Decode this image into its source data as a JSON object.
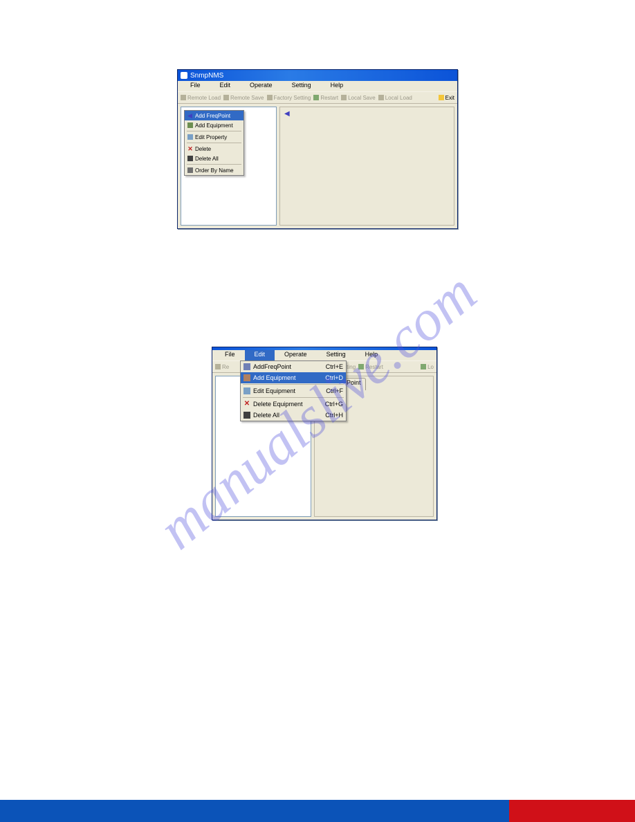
{
  "watermark": "manualslive.com",
  "window1": {
    "title": "SnmpNMS",
    "menubar": [
      "File",
      "Edit",
      "Operate",
      "Setting",
      "Help"
    ],
    "toolbar": {
      "items": [
        "Remote Load",
        "Remote Save",
        "Factory Setting",
        "Restart",
        "Local Save",
        "Local Load"
      ],
      "exit": "Exit"
    },
    "context_menu": [
      {
        "icon": "arrow",
        "label": "Add FreqPoint",
        "selected": true
      },
      {
        "icon": "add",
        "label": "Add Equipment"
      },
      {
        "sep": true
      },
      {
        "icon": "edit",
        "label": "Edit Property"
      },
      {
        "sep": true
      },
      {
        "icon": "del",
        "label": "Delete"
      },
      {
        "icon": "trash",
        "label": "Delete All"
      },
      {
        "sep": true
      },
      {
        "icon": "order",
        "label": "Order By Name"
      }
    ]
  },
  "window2": {
    "menubar": [
      "File",
      "Edit",
      "Operate",
      "Setting",
      "Help"
    ],
    "menubar_selected": 1,
    "toolbar": {
      "left": "Re",
      "right_items": [
        "Setting",
        "Restart"
      ],
      "right_last": "Lo"
    },
    "edit_menu": [
      {
        "icon": "afp",
        "label": "AddFreqPoint",
        "shortcut": "Ctrl+E"
      },
      {
        "icon": "aeq",
        "label": "Add Equipment",
        "shortcut": "Ctrl+D",
        "selected": true
      },
      {
        "sep": true
      },
      {
        "icon": "eeq",
        "label": "Edit Equipment",
        "shortcut": "Ctrl+F"
      },
      {
        "sep": true
      },
      {
        "icon": "deq",
        "label": "Delete Equipment",
        "shortcut": "Ctrl+G"
      },
      {
        "icon": "dall",
        "label": "Delete All",
        "shortcut": "Ctrl+H"
      }
    ],
    "tab_label": "Freq Point"
  }
}
